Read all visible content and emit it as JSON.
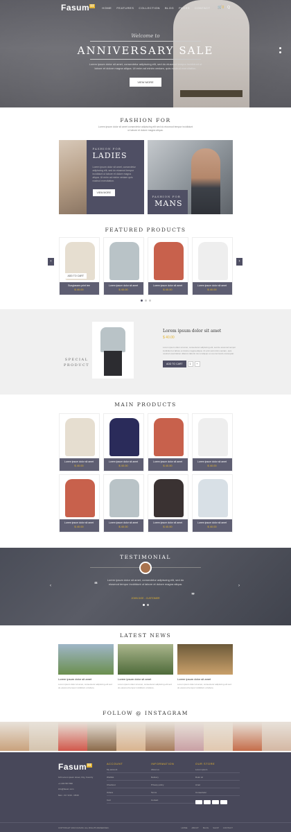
{
  "nav": {
    "logo": "Fasum",
    "menu": [
      "HOME",
      "FEATURES",
      "COLLECTION",
      "BLOG",
      "PAGES",
      "CONTACT"
    ],
    "cart_count": "0",
    "search": "Q"
  },
  "hero": {
    "script": "Welcome to",
    "title": "ANNIVERSARY SALE",
    "desc": "Lorem ipsum dolor sit amet, consectetur adipiscing elit, sed do eiusmod tempor incididunt ut labore et dolore magna aliqua. Ut enim ad minim veniam, quis nostrud exercitation.",
    "button": "VIEW MORE"
  },
  "fashion": {
    "title": "FASHION FOR",
    "sub": "Lorem ipsum dolor sit amet consectetur adipiscing elit sed do eiusmod tempor incididunt ut labore et dolore magna aliqua.",
    "ladies": {
      "small": "FASHION FOR",
      "big": "LADIES",
      "text": "Lorem ipsum dolor sit amet, consectetur adipiscing elit, sed do eiusmod tempor incididunt ut labore et dolore magna aliqua. Ut enim ad minim veniam quis nostrud exercitation.",
      "button": "VIEW MORE"
    },
    "mans": {
      "small": "FASHION FOR",
      "big": "MANS"
    }
  },
  "featured": {
    "title": "FEATURED PRODUCTS",
    "items": [
      {
        "name": "Sunglasses print tee",
        "price": "$ 40.00",
        "color": "#e6ded0",
        "action": "ADD TO CART"
      },
      {
        "name": "Lorem ipsum dolor sit amet",
        "price": "$ 40.00",
        "color": "#b9c3c7"
      },
      {
        "name": "Lorem ipsum dolor sit amet",
        "price": "$ 40.00",
        "color": "#c8614c"
      },
      {
        "name": "Lorem ipsum dolor sit amet",
        "price": "$ 40.00",
        "color": "#eeeeee"
      }
    ],
    "prev": "‹",
    "next": "›"
  },
  "special": {
    "label_1": "SPECIAL",
    "label_2": "PRODUCT",
    "title": "Lorem ipsum dolor sit amet",
    "price": "$ 40.00",
    "desc": "Lorem ipsum dolor sit amet, consectetur adipiscing elit, sed do eiusmod tempor incididunt ut labore et dolore magna aliqua. Ut enim ad minim veniam, quis nostrud exercitation ullamco laboris nisi ut aliquip ex ea commodo consequat.",
    "button": "ADD TO CART",
    "qty": "1",
    "plus": "+"
  },
  "main": {
    "title": "MAIN PRODUCTS",
    "items": [
      {
        "name": "Lorem ipsum dolor sit amet",
        "price": "$ 40.00",
        "color": "#e6ded0"
      },
      {
        "name": "Lorem ipsum dolor sit amet",
        "price": "$ 40.00",
        "color": "#2a2b5a"
      },
      {
        "name": "Lorem ipsum dolor sit amet",
        "price": "$ 40.00",
        "color": "#c8614c"
      },
      {
        "name": "Lorem ipsum dolor sit amet",
        "price": "$ 40.00",
        "color": "#eeeeee"
      },
      {
        "name": "Lorem ipsum dolor sit amet",
        "price": "$ 40.00",
        "color": "#c8614c"
      },
      {
        "name": "Lorem ipsum dolor sit amet",
        "price": "$ 40.00",
        "color": "#b9c3c7"
      },
      {
        "name": "Lorem ipsum dolor sit amet",
        "price": "$ 40.00",
        "color": "#3a3232"
      },
      {
        "name": "Lorem ipsum dolor sit amet",
        "price": "$ 40.00",
        "color": "#d8e0e6"
      }
    ]
  },
  "testimonial": {
    "title": "TESTIMONIAL",
    "quote": "Lorem ipsum dolor sit amet, consectetur adipiscing elit, sed do eiusmod tempor incididunt ut labore et dolore magna aliqua.",
    "author": "JOHN DOE - CUSTOMER"
  },
  "news": {
    "title": "LATEST NEWS",
    "items": [
      {
        "title": "Lorem ipsum dolor sit amet",
        "desc": "Lorem ipsum dolor sit amet, consectetur adipiscing elit sed do eiusmod tempor incididunt ut labore.",
        "colors": [
          "#6b8f4e",
          "#9fb6c7"
        ]
      },
      {
        "title": "Lorem ipsum dolor sit amet",
        "desc": "Lorem ipsum dolor sit amet, consectetur adipiscing elit sed do eiusmod tempor incididunt ut labore.",
        "colors": [
          "#4f6b3a",
          "#a9b58c"
        ]
      },
      {
        "title": "Lorem ipsum dolor sit amet",
        "desc": "Lorem ipsum dolor sit amet, consectetur adipiscing elit sed do eiusmod tempor incididunt ut labore.",
        "colors": [
          "#c9a06a",
          "#6d5a3a"
        ]
      }
    ]
  },
  "instagram": {
    "title": "FOLLOW @ INSTAGRAM",
    "colors": [
      "#c9a27c",
      "#d5c4ae",
      "#d1584b",
      "#8b6a4a",
      "#d9b48f",
      "#a67b5b",
      "#c9a0a4",
      "#e1c8b0",
      "#c56d4a",
      "#d4b8a3"
    ]
  },
  "footer": {
    "logo": "Fasum",
    "contact": [
      "123 Lorem ipsum street, City, Country",
      "+1 234 567 890",
      "info@fasum.com",
      "Mon - Fri: 9:00 - 18:00"
    ],
    "col1": {
      "title": "ACCOUNT",
      "items": [
        "My account",
        "Wishlist",
        "Checkout",
        "Orders",
        "Cart"
      ]
    },
    "col2": {
      "title": "INFORMATION",
      "items": [
        "About us",
        "Delivery",
        "Privacy policy",
        "Terms",
        "Contact"
      ]
    },
    "col3": {
      "title": "OUR STORE",
      "items": [
        "Lorem ipsum",
        "Dolor sit",
        "Amet",
        "Consectetur"
      ]
    },
    "copyright": "COPYRIGHT 2016 FASUM. ALL RIGHTS RESERVED.",
    "links": [
      "HOME",
      "ABOUT",
      "BLOG",
      "SHOP",
      "CONTACT"
    ]
  }
}
